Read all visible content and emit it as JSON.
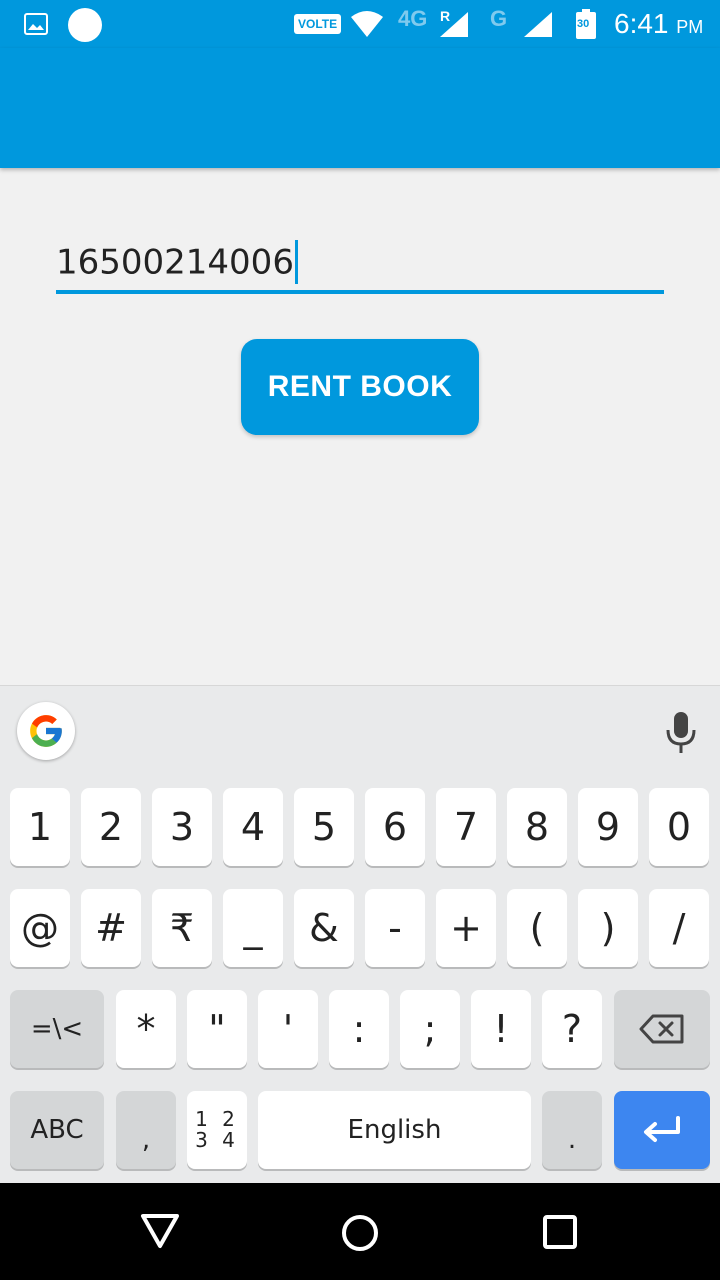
{
  "status_bar": {
    "volte_label": "VOLTE",
    "network_4g": "4G",
    "roaming": "R",
    "network_g": "G",
    "battery_level": "30",
    "time": "6:41",
    "ampm": "PM",
    "icons": [
      "gallery-icon",
      "circle-notification-icon",
      "wifi-icon",
      "signal-icon",
      "signal-icon",
      "battery-icon"
    ]
  },
  "form": {
    "book_id_value": "16500214006",
    "rent_button_label": "RENT BOOK",
    "accent_color": "#0098dd"
  },
  "keyboard": {
    "row1": [
      "1",
      "2",
      "3",
      "4",
      "5",
      "6",
      "7",
      "8",
      "9",
      "0"
    ],
    "row2": [
      "@",
      "#",
      "₹",
      "_",
      "&",
      "-",
      "+",
      "(",
      ")",
      "/"
    ],
    "row3": [
      "=\\<",
      "*",
      "\"",
      "'",
      ":",
      ";",
      "!",
      "?"
    ],
    "row4": {
      "abc": "ABC",
      "comma": ",",
      "numpad_top": "1 2",
      "numpad_bottom": "3 4",
      "space": "English",
      "period": "."
    },
    "enter_color": "#3d86f0"
  }
}
